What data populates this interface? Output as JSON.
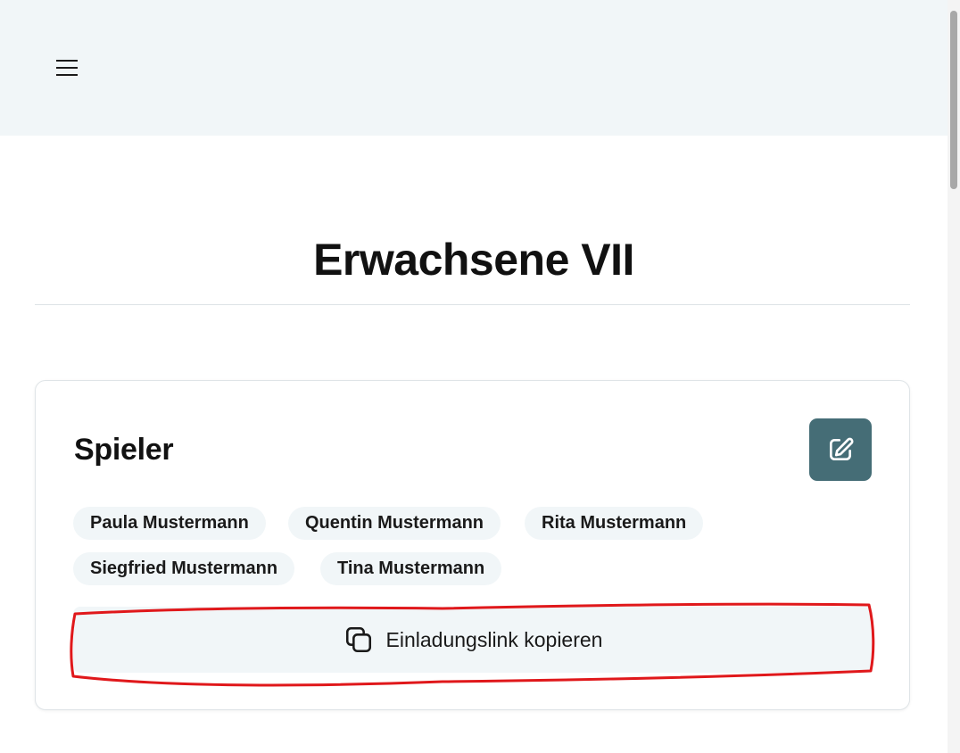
{
  "header": {
    "menu_icon": "hamburger-menu-icon"
  },
  "page": {
    "title": "Erwachsene VII"
  },
  "players_card": {
    "title": "Spieler",
    "edit_icon": "pencil-square-icon",
    "players": [
      "Paula Mustermann",
      "Quentin Mustermann",
      "Rita Mustermann",
      "Siegfried Mustermann",
      "Tina Mustermann"
    ],
    "invite_button_label": "Einladungslink kopieren",
    "invite_icon": "copy-icon"
  },
  "colors": {
    "header_bg": "#f1f6f8",
    "edit_button_bg": "#456d76",
    "chip_bg": "#f1f6f8",
    "annotation": "#e0181b"
  }
}
